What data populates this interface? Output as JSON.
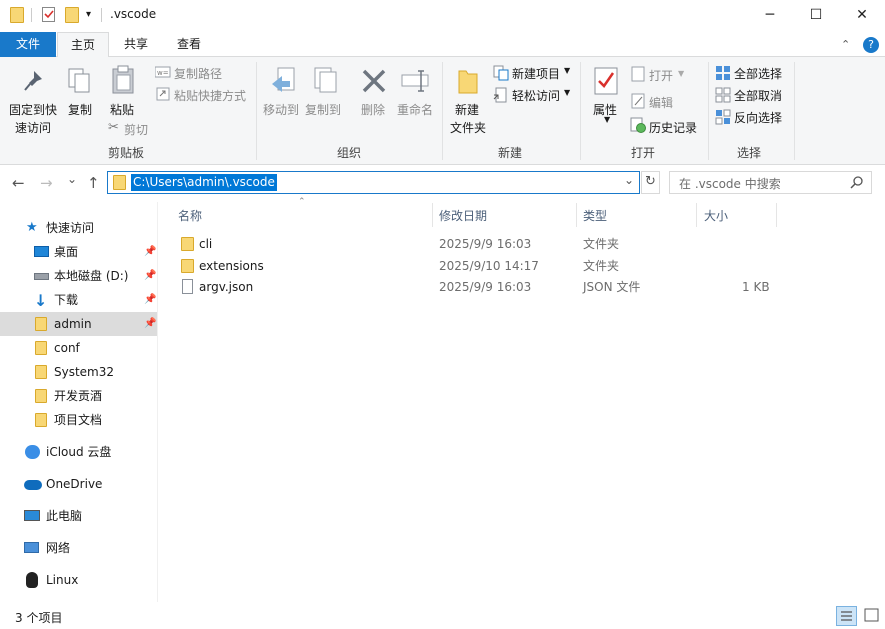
{
  "window": {
    "title": ".vscode",
    "minimize": "─",
    "maximize": "☐",
    "close": "✕"
  },
  "ribbon_tabs": [
    {
      "label": "文件"
    },
    {
      "label": "主页"
    },
    {
      "label": "共享"
    },
    {
      "label": "查看"
    }
  ],
  "ribbon": {
    "clipboard": {
      "pin_quick_access_1": "固定到快",
      "pin_quick_access_2": "速访问",
      "copy": "复制",
      "paste": "粘贴",
      "copy_path": "复制路径",
      "paste_shortcut": "粘贴快捷方式",
      "cut": "剪切",
      "group_label": "剪贴板"
    },
    "organize": {
      "move_to": "移动到",
      "copy_to": "复制到",
      "delete": "删除",
      "rename": "重命名",
      "group_label": "组织"
    },
    "new": {
      "new_folder_1": "新建",
      "new_folder_2": "文件夹",
      "new_item": "新建项目",
      "easy_access": "轻松访问",
      "group_label": "新建"
    },
    "open": {
      "properties": "属性",
      "open": "打开",
      "edit": "编辑",
      "history": "历史记录",
      "group_label": "打开"
    },
    "select": {
      "select_all": "全部选择",
      "select_none": "全部取消",
      "invert": "反向选择",
      "group_label": "选择"
    }
  },
  "nav": {
    "back": "←",
    "forward": "→",
    "recent": "⌄",
    "up": "↑",
    "address": "C:\\Users\\admin\\.vscode",
    "search_placeholder": "在 .vscode 中搜索",
    "dropdown": "⌄",
    "refresh": "↻"
  },
  "sidebar": {
    "quick_access": "快速访问",
    "pinned": [
      {
        "label": "桌面"
      },
      {
        "label": "本地磁盘 (D:)"
      },
      {
        "label": "下载"
      },
      {
        "label": "admin"
      }
    ],
    "recent": [
      {
        "label": "conf"
      },
      {
        "label": "System32"
      },
      {
        "label": "开发贡酒"
      },
      {
        "label": "项目文档"
      }
    ],
    "roots": [
      {
        "label": "iCloud 云盘"
      },
      {
        "label": "OneDrive"
      },
      {
        "label": "此电脑"
      },
      {
        "label": "网络"
      },
      {
        "label": "Linux"
      }
    ]
  },
  "list": {
    "columns": {
      "name": "名称",
      "modified": "修改日期",
      "type": "类型",
      "size": "大小"
    },
    "rows": [
      {
        "name": "cli",
        "modified": "2025/9/9 16:03",
        "type": "文件夹",
        "size": ""
      },
      {
        "name": "extensions",
        "modified": "2025/9/10 14:17",
        "type": "文件夹",
        "size": ""
      },
      {
        "name": "argv.json",
        "modified": "2025/9/9 16:03",
        "type": "JSON 文件",
        "size": "1 KB"
      }
    ]
  },
  "status": {
    "count": "3 个项目"
  },
  "colors": {
    "accent": "#1979ca",
    "folder": "#f8d775",
    "selection": "#0078d7"
  }
}
